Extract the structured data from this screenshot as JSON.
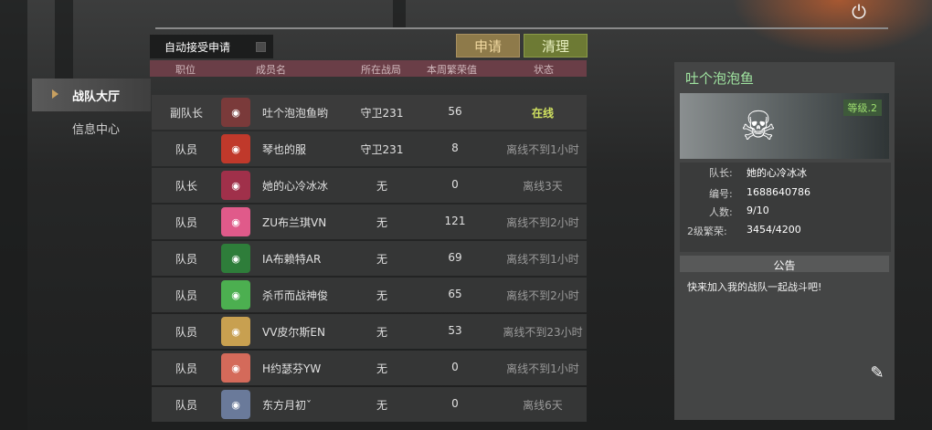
{
  "header": {
    "power_icon": "power-icon"
  },
  "nav": {
    "items": [
      {
        "label": "战队大厅",
        "active": true
      },
      {
        "label": "信息中心",
        "active": false
      }
    ]
  },
  "toolbar": {
    "auto_accept_label": "自动接受申请",
    "auto_accept_checked": false,
    "apply_label": "申请",
    "clear_label": "清理"
  },
  "table": {
    "headers": [
      "职位",
      "成员名",
      "所在战局",
      "本周繁荣值",
      "状态"
    ],
    "rows": [
      {
        "role": "副队长",
        "name": "吐个泡泡鱼哟",
        "battle": "守卫231",
        "honor": "56",
        "status": "在线",
        "online": true
      },
      {
        "role": "队员",
        "name": "琴也的服",
        "battle": "守卫231",
        "honor": "8",
        "status": "离线不到1小时",
        "online": false
      },
      {
        "role": "队长",
        "name": "她的心冷冰冰",
        "battle": "无",
        "honor": "0",
        "status": "离线3天",
        "online": false
      },
      {
        "role": "队员",
        "name": "ZU布兰琪VN",
        "battle": "无",
        "honor": "121",
        "status": "离线不到2小时",
        "online": false
      },
      {
        "role": "队员",
        "name": "IA布赖特AR",
        "battle": "无",
        "honor": "69",
        "status": "离线不到1小时",
        "online": false
      },
      {
        "role": "队员",
        "name": "杀币而战神俊",
        "battle": "无",
        "honor": "65",
        "status": "离线不到2小时",
        "online": false
      },
      {
        "role": "队员",
        "name": "VV皮尔斯EN",
        "battle": "无",
        "honor": "53",
        "status": "离线不到23小时",
        "online": false
      },
      {
        "role": "队员",
        "name": "H约瑟芬YW",
        "battle": "无",
        "honor": "0",
        "status": "离线不到1小时",
        "online": false
      },
      {
        "role": "队员",
        "name": "东方月初ˇ",
        "battle": "无",
        "honor": "0",
        "status": "离线6天",
        "online": false
      }
    ]
  },
  "team": {
    "name": "吐个泡泡鱼",
    "level": "等级.2",
    "leader_label": "队长:",
    "leader": "她的心冷冰冰",
    "id_label": "编号:",
    "id": "1688640786",
    "count_label": "人数:",
    "count": "9/10",
    "prosperity_label": "2级繁荣:",
    "prosperity": "3454/4200",
    "notice_title": "公告",
    "notice_text": "快来加入我的战队一起战斗吧!"
  },
  "colors": {
    "online": "#cfe060",
    "team_name": "#9fe3a0",
    "header_bar": "#6a3e47"
  }
}
